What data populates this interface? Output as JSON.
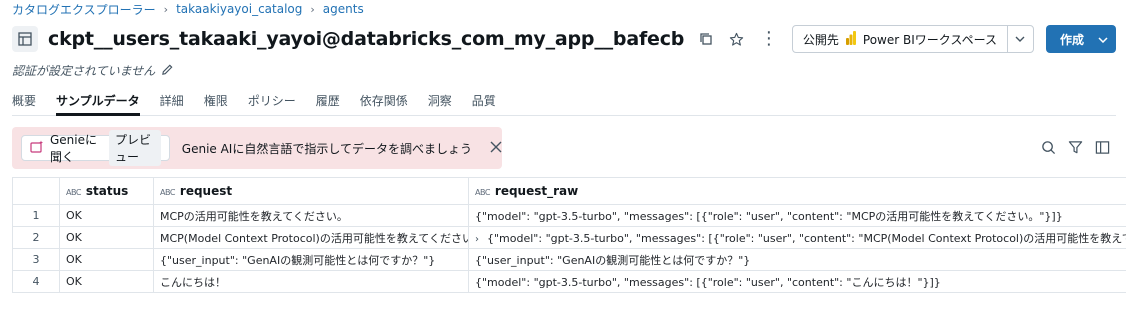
{
  "breadcrumb": {
    "items": [
      "カタログエクスプローラー",
      "takaakiyayoi_catalog",
      "agents"
    ],
    "separator": "›"
  },
  "header": {
    "title": "ckpt__users_takaaki_yayoi@databricks_com_my_app__bafecb",
    "icons": [
      "table-icon",
      "copy-icon",
      "star-icon",
      "more-vertical-icon"
    ],
    "publish_label": "公開先",
    "publish_target": "Power BIワークスペース",
    "create_label": "作成"
  },
  "subtitle": "認証が設定されていません",
  "tabs": [
    {
      "label": "概要",
      "active": false
    },
    {
      "label": "サンプルデータ",
      "active": true
    },
    {
      "label": "詳細",
      "active": false
    },
    {
      "label": "権限",
      "active": false
    },
    {
      "label": "ポリシー",
      "active": false
    },
    {
      "label": "履歴",
      "active": false
    },
    {
      "label": "依存関係",
      "active": false
    },
    {
      "label": "洞察",
      "active": false
    },
    {
      "label": "品質",
      "active": false
    }
  ],
  "genie": {
    "chip_label": "Genieに聞く",
    "badge": "プレビュー",
    "message": "Genie AIに自然言語で指示してデータを調べましょう"
  },
  "table": {
    "columns": [
      {
        "name": "status",
        "type_icon": "ABC"
      },
      {
        "name": "request",
        "type_icon": "ABC"
      },
      {
        "name": "request_raw",
        "type_icon": "ABC"
      }
    ],
    "rows": [
      {
        "num": "1",
        "status": "OK",
        "request": "MCPの活用可能性を教えてください。",
        "request_raw": "{\"model\": \"gpt-3.5-turbo\", \"messages\": [{\"role\": \"user\", \"content\": \"MCPの活用可能性を教えてください。\"}]}",
        "expandable": false
      },
      {
        "num": "2",
        "status": "OK",
        "request": "MCP(Model Context Protocol)の活用可能性を教えてください。",
        "request_raw": "{\"model\": \"gpt-3.5-turbo\", \"messages\": [{\"role\": \"user\", \"content\": \"MCP(Model Context Protocol)の活用可能性を教えてくださ",
        "expandable": true
      },
      {
        "num": "3",
        "status": "OK",
        "request": "{\"user_input\": \"GenAIの観測可能性とは何ですか？\"}",
        "request_raw": "{\"user_input\": \"GenAIの観測可能性とは何ですか？\"}",
        "expandable": false
      },
      {
        "num": "4",
        "status": "OK",
        "request": "こんにちは！",
        "request_raw": "{\"model\": \"gpt-3.5-turbo\", \"messages\": [{\"role\": \"user\", \"content\": \"こんにちは！\"}]}",
        "expandable": false
      }
    ]
  },
  "colors": {
    "accent": "#2272b4",
    "genie_bg": "#f8e2e4",
    "powerbi": "#f2c811"
  }
}
